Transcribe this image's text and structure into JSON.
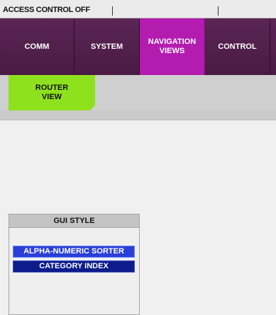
{
  "status_bar": {
    "text": "ACCESS CONTROL OFF"
  },
  "tabs": [
    {
      "label": "COMM",
      "active": false
    },
    {
      "label": "SYSTEM",
      "active": false
    },
    {
      "label": "NAVIGATION\nVIEWS",
      "active": true
    },
    {
      "label": "CONTROL",
      "active": false
    }
  ],
  "subtabs": [
    {
      "label": "ROUTER\nVIEW",
      "active": true
    }
  ],
  "gui_style": {
    "title": "GUI STYLE",
    "options": [
      {
        "label": "ALPHA-NUMERIC SORTER"
      },
      {
        "label": "CATEGORY INDEX"
      }
    ]
  },
  "colors": {
    "tab_bg": "#4a1a43",
    "tab_active": "#b41cb0",
    "subtab_active": "#8ee21d",
    "button_blue": "#2a3fd6",
    "button_navy": "#0d1c8a"
  }
}
